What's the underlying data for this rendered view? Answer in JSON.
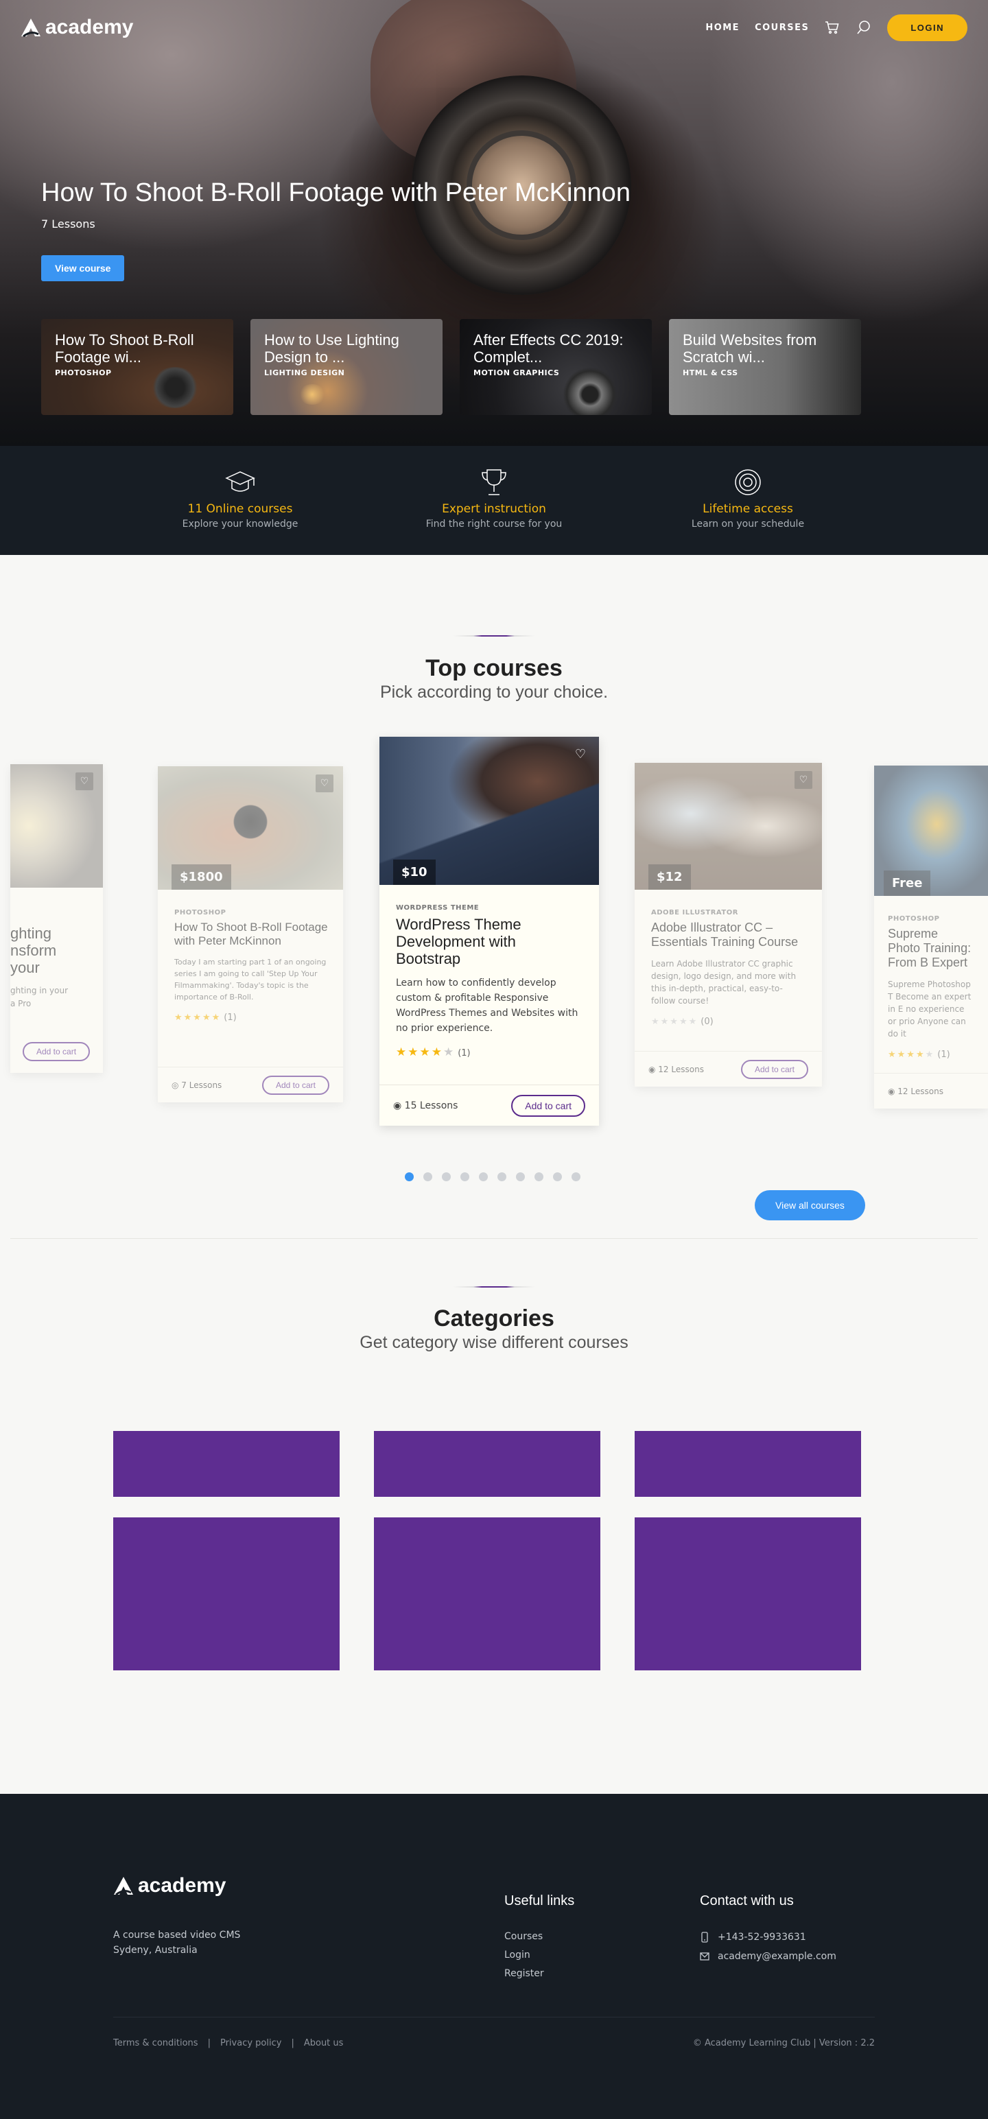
{
  "nav": {
    "brand": "academy",
    "links": [
      "HOME",
      "COURSES"
    ],
    "login": "LOGIN"
  },
  "hero": {
    "title": "How To Shoot B-Roll Footage with Peter McKinnon",
    "lessons": "7 Lessons",
    "button": "View course",
    "cards": [
      {
        "title": "How To Shoot B-Roll Footage wi...",
        "category": "PHOTOSHOP"
      },
      {
        "title": "How to Use Lighting Design to ...",
        "category": "LIGHTING DESIGN"
      },
      {
        "title": "After Effects CC 2019: Complet...",
        "category": "MOTION GRAPHICS"
      },
      {
        "title": "Build Websites from Scratch wi...",
        "category": "HTML & CSS"
      }
    ]
  },
  "features": [
    {
      "icon": "graduation-cap-icon",
      "title": "11 Online courses",
      "subtitle": "Explore your knowledge"
    },
    {
      "icon": "trophy-icon",
      "title": "Expert instruction",
      "subtitle": "Find the right course for you"
    },
    {
      "icon": "target-icon",
      "title": "Lifetime access",
      "subtitle": "Learn on your schedule"
    }
  ],
  "top_courses": {
    "title": "Top courses",
    "subtitle": "Pick according to your choice.",
    "cards": [
      {
        "title": "ghting\nnsform your",
        "description": "ghting in your\na Pro",
        "button": "Add to cart"
      },
      {
        "price": "$1800",
        "category": "PHOTOSHOP",
        "title": "How To Shoot B-Roll Footage with Peter McKinnon",
        "description": "Today I am starting part 1 of an ongoing series I am going to call 'Step Up Your Filmammaking'. Today's topic is the importance of B-Roll.",
        "rating": 5,
        "count": "(1)",
        "lessons": "7 Lessons",
        "button": "Add to cart"
      },
      {
        "price": "$10",
        "category": "WORDPRESS THEME",
        "title": "WordPress Theme Development with Bootstrap",
        "description": "Learn how to confidently develop custom & profitable Responsive WordPress Themes and Websites with no prior experience.",
        "rating": 4,
        "count": "(1)",
        "lessons": "15 Lessons",
        "button": "Add to cart"
      },
      {
        "price": "$12",
        "category": "ADOBE ILLUSTRATOR",
        "title": "Adobe Illustrator CC – Essentials Training Course",
        "description": "Learn Adobe Illustrator CC graphic design, logo design, and more with this in-depth, practical, easy-to-follow course!",
        "rating": 0,
        "count": "(0)",
        "lessons": "12 Lessons",
        "button": "Add to cart"
      },
      {
        "price": "Free",
        "category": "PHOTOSHOP",
        "title": "Supreme Photo Training: From B Expert",
        "description": "Supreme Photoshop T Become an expert in E no experience or prio Anyone can do it",
        "rating": 4,
        "count": "(1)",
        "lessons": "12 Lessons"
      }
    ],
    "view_all": "View all courses",
    "dot_count": 10,
    "active_dot": 0
  },
  "categories": {
    "title": "Categories",
    "subtitle": "Get category wise different courses"
  },
  "footer": {
    "brand": "academy",
    "address_line1": "A course based video CMS",
    "address_line2": "Sydeny, Australia",
    "useful_heading": "Useful links",
    "useful_links": [
      "Courses",
      "Login",
      "Register"
    ],
    "contact_heading": "Contact with us",
    "phone": "+143-52-9933631",
    "email": "academy@example.com",
    "bottom_links": [
      "Terms & conditions",
      "Privacy policy",
      "About us"
    ],
    "copyright": "© Academy Learning Club | Version : 2.2"
  },
  "colors": {
    "accent_yellow": "#f6b812",
    "accent_blue": "#3a95f2",
    "brand_purple": "#5e2d91",
    "dark_bg": "#171d24"
  }
}
